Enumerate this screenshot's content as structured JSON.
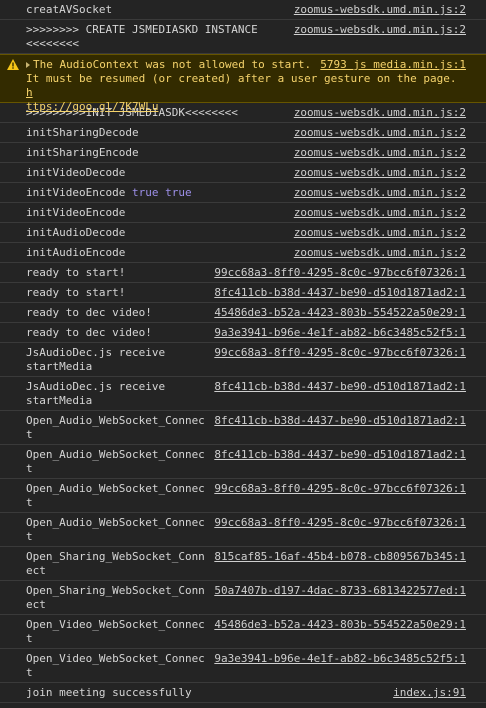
{
  "rows": [
    {
      "text": "creatAVSocket",
      "src": "zoomus-websdk.umd.min.js:2"
    },
    {
      "text": ">>>>>>>> CREATE JSMEDIASKD INSTANCE\n<<<<<<<<",
      "src": "zoomus-websdk.umd.min.js:2"
    },
    {
      "warning": true,
      "text": "The AudioContext was not allowed to start.",
      "src": "5793 js media.min.js:1",
      "text2": "It must be resumed (or created) after a user gesture on the page.",
      "link_a": "h",
      "link_b": "ttps://goo.gl/7K7WLu"
    },
    {
      "text": ">>>>>>>>>INIT JSMEDIASDK<<<<<<<<",
      "src": "zoomus-websdk.umd.min.js:2"
    },
    {
      "text": "initSharingDecode",
      "src": "zoomus-websdk.umd.min.js:2"
    },
    {
      "text": "initSharingEncode",
      "src": "zoomus-websdk.umd.min.js:2"
    },
    {
      "text": "initVideoDecode",
      "src": "zoomus-websdk.umd.min.js:2"
    },
    {
      "text": "initVideoEncode",
      "extra": "true true",
      "src": "zoomus-websdk.umd.min.js:2"
    },
    {
      "text": "initVideoEncode",
      "src": "zoomus-websdk.umd.min.js:2"
    },
    {
      "text": "initAudioDecode",
      "src": "zoomus-websdk.umd.min.js:2"
    },
    {
      "text": "initAudioEncode",
      "src": "zoomus-websdk.umd.min.js:2"
    },
    {
      "text": "ready to start!",
      "src": "99cc68a3-8ff0-4295-8c0c-97bcc6f07326:1"
    },
    {
      "text": "ready to start!",
      "src": "8fc411cb-b38d-4437-be90-d510d1871ad2:1"
    },
    {
      "text": "ready to dec video!",
      "src": "45486de3-b52a-4423-803b-554522a50e29:1"
    },
    {
      "text": "ready to dec video!",
      "src": "9a3e3941-b96e-4e1f-ab82-b6c3485c52f5:1"
    },
    {
      "text": "JsAudioDec.js receive\nstartMedia",
      "src": "99cc68a3-8ff0-4295-8c0c-97bcc6f07326:1"
    },
    {
      "text": "JsAudioDec.js receive\nstartMedia",
      "src": "8fc411cb-b38d-4437-be90-d510d1871ad2:1"
    },
    {
      "text": "Open_Audio_WebSocket_Connec\nt",
      "src": "8fc411cb-b38d-4437-be90-d510d1871ad2:1"
    },
    {
      "text": "Open_Audio_WebSocket_Connec\nt",
      "src": "8fc411cb-b38d-4437-be90-d510d1871ad2:1"
    },
    {
      "text": "Open_Audio_WebSocket_Connec\nt",
      "src": "99cc68a3-8ff0-4295-8c0c-97bcc6f07326:1"
    },
    {
      "text": "Open_Audio_WebSocket_Connec\nt",
      "src": "99cc68a3-8ff0-4295-8c0c-97bcc6f07326:1"
    },
    {
      "text": "Open_Sharing_WebSocket_Conn\nect",
      "src": "815caf85-16af-45b4-b078-cb809567b345:1"
    },
    {
      "text": "Open_Sharing_WebSocket_Conn\nect",
      "src": "50a7407b-d197-4dac-8733-6813422577ed:1"
    },
    {
      "text": "Open_Video_WebSocket_Connec\nt",
      "src": "45486de3-b52a-4423-803b-554522a50e29:1"
    },
    {
      "text": "Open_Video_WebSocket_Connec\nt",
      "src": "9a3e3941-b96e-4e1f-ab82-b6c3485c52f5:1"
    },
    {
      "text": "join meeting successfully",
      "src": "index.js:91"
    }
  ]
}
